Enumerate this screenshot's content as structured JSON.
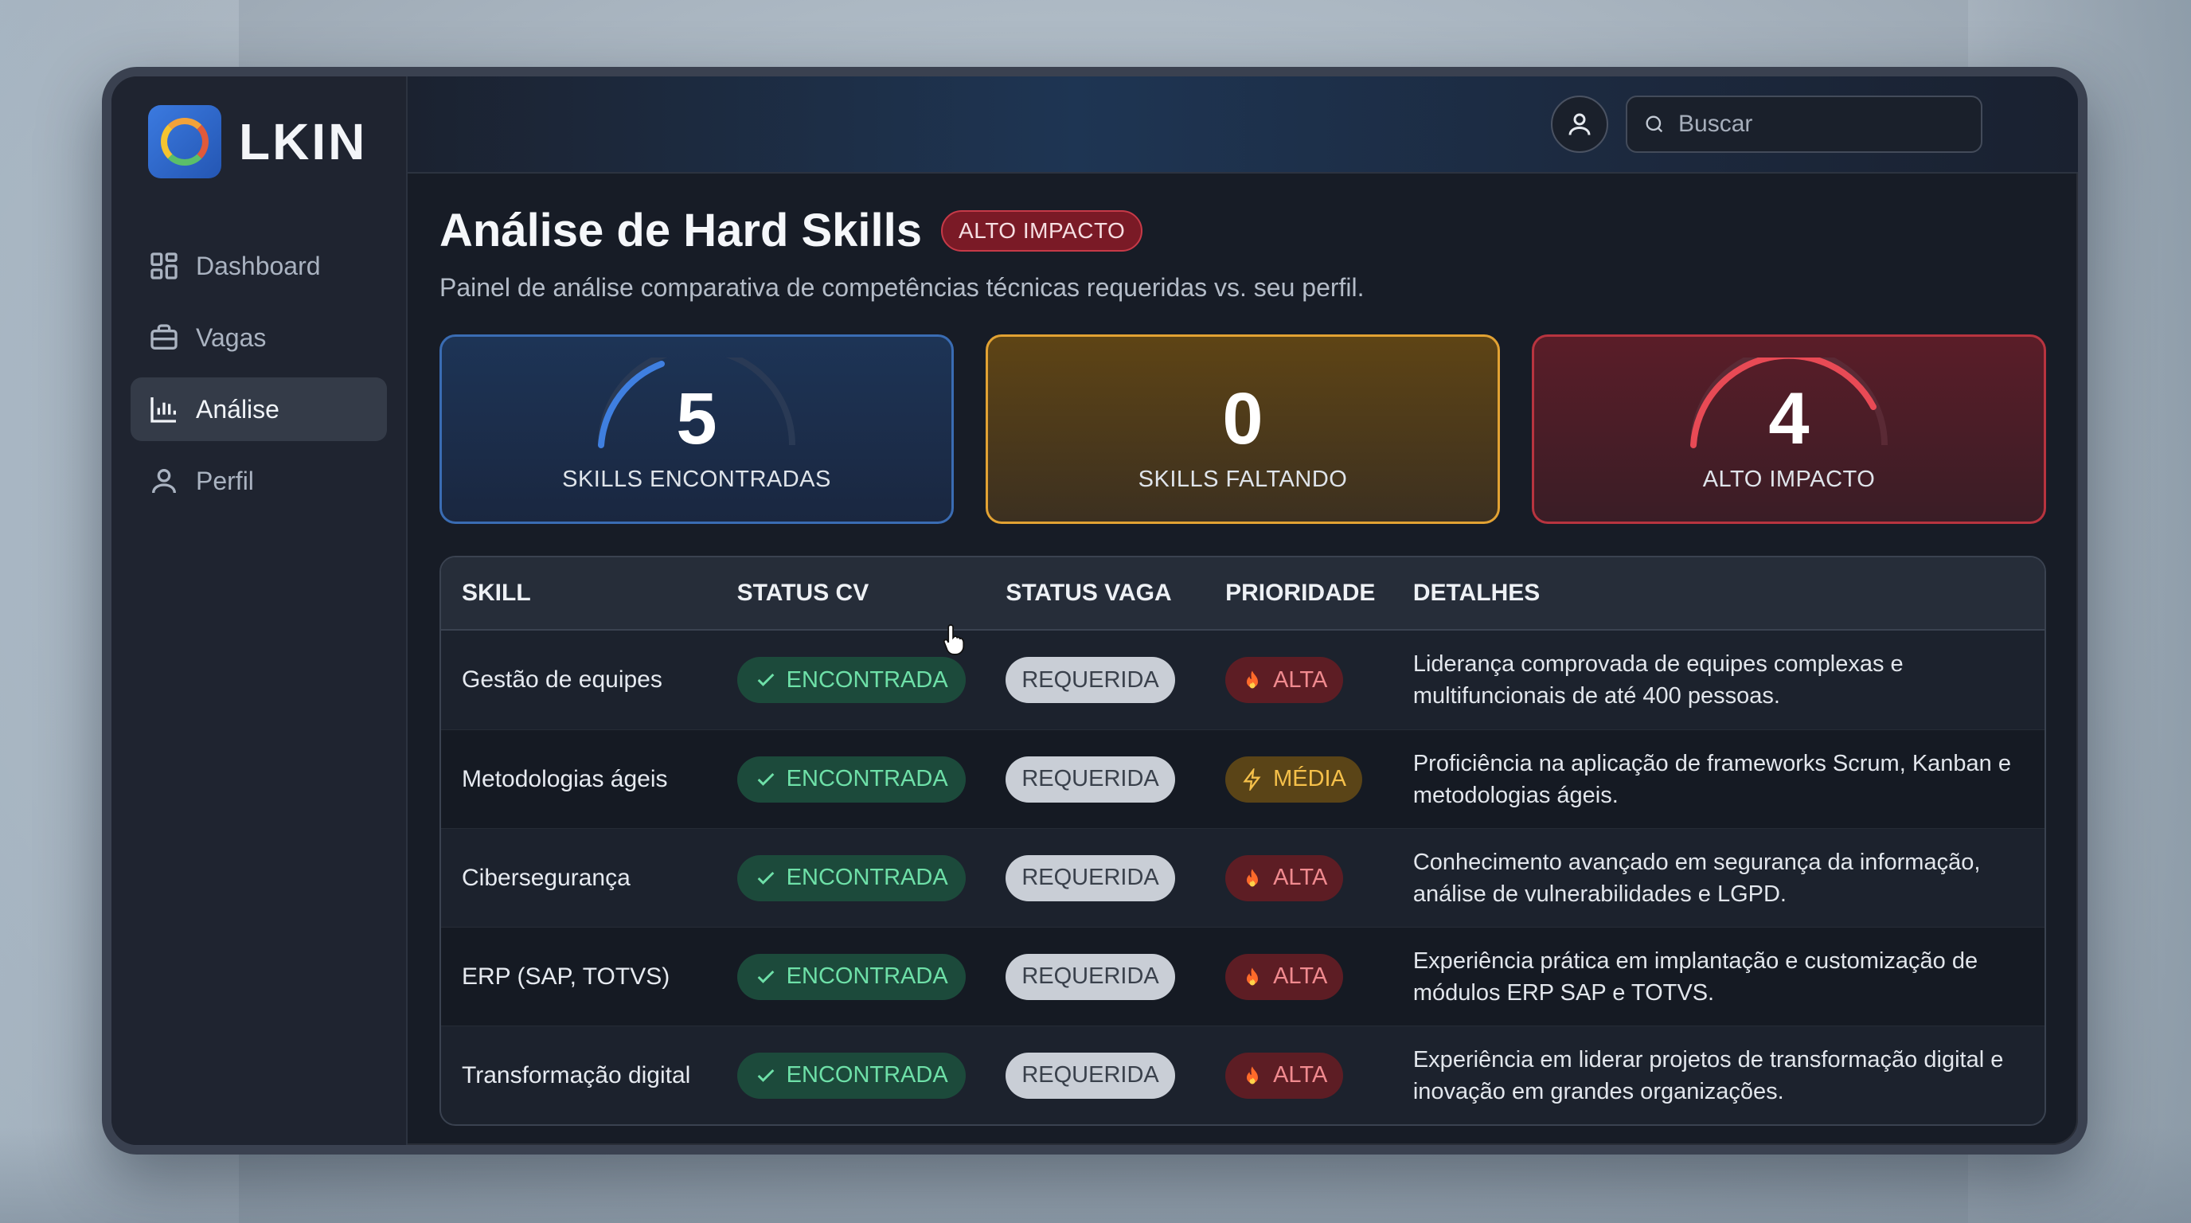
{
  "brand": {
    "name": "LKIN"
  },
  "sidebar": {
    "items": [
      {
        "label": "Dashboard",
        "icon": "grid-icon",
        "active": false
      },
      {
        "label": "Vagas",
        "icon": "briefcase-icon",
        "active": false
      },
      {
        "label": "Análise",
        "icon": "bar-chart-icon",
        "active": true
      },
      {
        "label": "Perfil",
        "icon": "user-icon",
        "active": false
      }
    ]
  },
  "topbar": {
    "search_placeholder": "Buscar"
  },
  "header": {
    "title": "Análise de Hard Skills",
    "badge": "ALTO IMPACTO",
    "subtitle": "Painel de análise comparativa de competências técnicas requeridas vs. seu perfil."
  },
  "cards": [
    {
      "value": "5",
      "label": "SKILLS ENCONTRADAS",
      "color": "#3a6cb3"
    },
    {
      "value": "0",
      "label": "SKILLS FALTANDO",
      "color": "#e2a233"
    },
    {
      "value": "4",
      "label": "ALTO IMPACTO",
      "color": "#b8343f"
    }
  ],
  "table": {
    "headers": [
      "SKILL",
      "STATUS CV",
      "STATUS VAGA",
      "PRIORIDADE",
      "DETALHES"
    ],
    "rows": [
      {
        "skill": "Gestão de equipes",
        "cv": "ENCONTRADA",
        "vaga": "REQUERIDA",
        "priority": "ALTA",
        "priority_icon": "fire-icon",
        "detail": "Liderança comprovada de equipes complexas e multifuncionais de até 400 pessoas."
      },
      {
        "skill": "Metodologias ágeis",
        "cv": "ENCONTRADA",
        "vaga": "REQUERIDA",
        "priority": "MÉDIA",
        "priority_icon": "bolt-icon",
        "detail": "Proficiência na aplicação de frameworks Scrum, Kanban e metodologias ágeis."
      },
      {
        "skill": "Cibersegurança",
        "cv": "ENCONTRADA",
        "vaga": "REQUERIDA",
        "priority": "ALTA",
        "priority_icon": "fire-icon",
        "detail": "Conhecimento avançado em segurança da informação, análise de vulnerabilidades e LGPD."
      },
      {
        "skill": "ERP (SAP, TOTVS)",
        "cv": "ENCONTRADA",
        "vaga": "REQUERIDA",
        "priority": "ALTA",
        "priority_icon": "fire-icon",
        "detail": "Experiência prática em implantação e customização de módulos ERP SAP e TOTVS."
      },
      {
        "skill": "Transformação digital",
        "cv": "ENCONTRADA",
        "vaga": "REQUERIDA",
        "priority": "ALTA",
        "priority_icon": "fire-icon",
        "detail": "Experiência em liderar projetos de transformação digital e inovação em grandes organizações."
      }
    ]
  }
}
